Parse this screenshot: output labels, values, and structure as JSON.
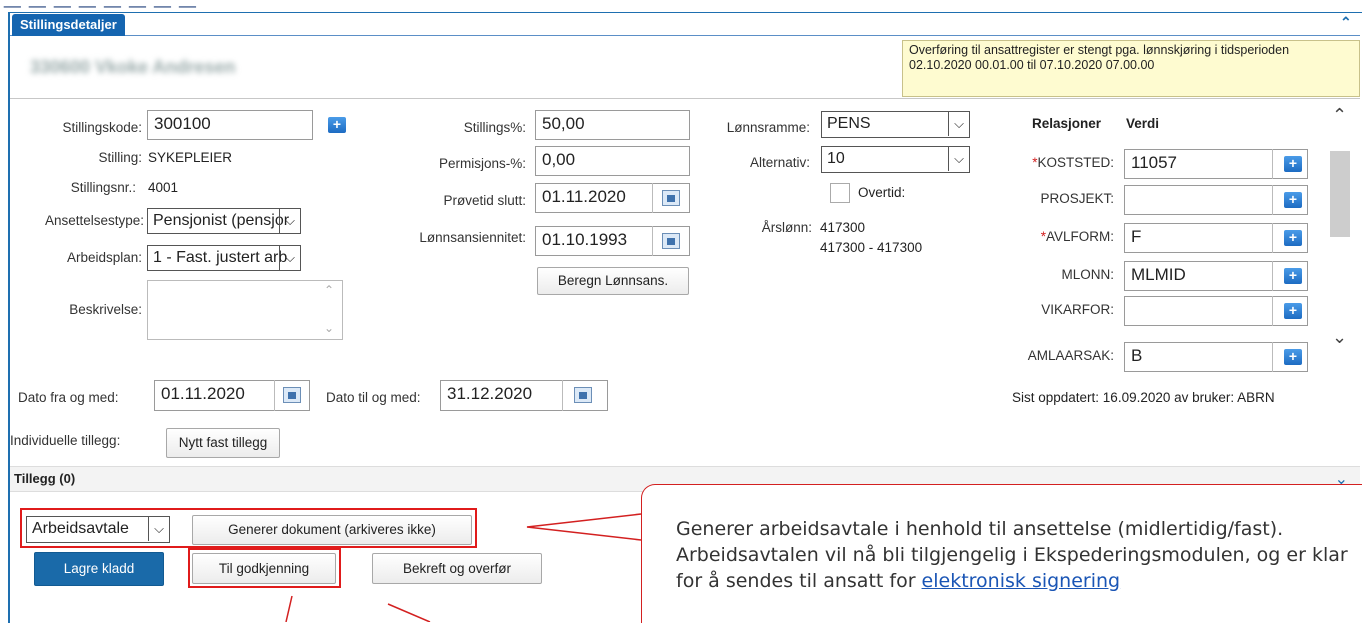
{
  "panel": {
    "tab_label": "Stillingsdetaljer",
    "employee_name_blurred": "330600 Vkoke Andresen",
    "notice": "Overføring til ansattregister er stengt pga. lønnskjøring i tidsperioden 02.10.2020 00.01.00 til 07.10.2020 07.00.00"
  },
  "col1": {
    "stillingskode_label": "Stillingskode:",
    "stillingskode_value": "300100",
    "stilling_label": "Stilling:",
    "stilling_value": "SYKEPLEIER",
    "stillingsnr_label": "Stillingsnr.:",
    "stillingsnr_value": "4001",
    "ansettelsestype_label": "Ansettelsestype:",
    "ansettelsestype_value": "Pensjonist (pensjor",
    "arbeidsplan_label": "Arbeidsplan:",
    "arbeidsplan_value": "1 - Fast. justert arb",
    "beskrivelse_label": "Beskrivelse:"
  },
  "col2": {
    "stillingspct_label": "Stillings%:",
    "stillingspct_value": "50,00",
    "permisjon_label": "Permisjons-%:",
    "permisjon_value": "0,00",
    "provetid_label": "Prøvetid slutt:",
    "provetid_value": "01.11.2020",
    "lonnsans_label": "Lønnsansiennitet:",
    "lonnsans_value": "01.10.1993",
    "beregn_button": "Beregn Lønnsans."
  },
  "col3": {
    "lonnsramme_label": "Lønnsramme:",
    "lonnsramme_value": "PENS",
    "alternativ_label": "Alternativ:",
    "alternativ_value": "10",
    "overtid_label": "Overtid:",
    "arslonn_label": "Årslønn:",
    "arslonn_value": "417300",
    "arslonn_range": "417300 - 417300"
  },
  "relations": {
    "header_rel": "Relasjoner",
    "header_val": "Verdi",
    "rows": [
      {
        "label": "*KOSTSTED:",
        "value": "11057"
      },
      {
        "label": "PROSJEKT:",
        "value": ""
      },
      {
        "label": "*AVLFORM:",
        "value": "F"
      },
      {
        "label": "MLONN:",
        "value": "MLMID"
      },
      {
        "label": "VIKARFOR:",
        "value": ""
      },
      {
        "label": "AMLAARSAK:",
        "value": "B"
      }
    ]
  },
  "dates": {
    "fra_label": "Dato fra og med:",
    "fra_value": "01.11.2020",
    "til_label": "Dato til og med:",
    "til_value": "31.12.2020",
    "updated": "Sist oppdatert: 16.09.2020 av bruker: ABRN"
  },
  "tillegg": {
    "individual_label": "Individuelle tillegg:",
    "new_button": "Nytt fast tillegg",
    "section_label": "Tillegg (0)"
  },
  "actions": {
    "doc_select": "Arbeidsavtale",
    "generate_button": "Generer dokument (arkiveres ikke)",
    "save_button": "Lagre kladd",
    "approve_button": "Til godkjenning",
    "confirm_button": "Bekreft og overfør"
  },
  "callout": {
    "text_part1": "Generer arbeidsavtale i henhold til ansettelse (midlertidig/fast). Arbeidsavtalen vil nå bli tilgjengelig i Ekspederingsmodulen, og er klar for å sendes til ansatt for ",
    "link": "elektronisk signering"
  },
  "colors": {
    "accent": "#1565b0",
    "highlight": "#e01b1b",
    "notice_bg": "#fefbd0"
  }
}
